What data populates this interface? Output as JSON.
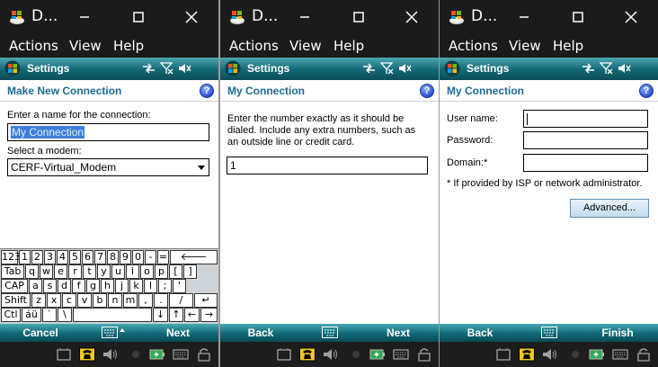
{
  "window": {
    "title": "D..."
  },
  "menu": {
    "actions": "Actions",
    "view": "View",
    "help": "Help"
  },
  "status": {
    "title": "Settings"
  },
  "panels": [
    {
      "heading": "Make New Connection",
      "name_label": "Enter a name for the connection:",
      "name_value": "My Connection",
      "modem_label": "Select a modem:",
      "modem_value": "CERF-Virtual_Modem",
      "left_soft": "Cancel",
      "right_soft": "Next"
    },
    {
      "heading": "My Connection",
      "instructions": "Enter the number exactly as it should be dialed.  Include any extra numbers, such as an outside line or credit card.",
      "number_value": "1",
      "left_soft": "Back",
      "right_soft": "Next"
    },
    {
      "heading": "My Connection",
      "username_label": "User name:",
      "username_value": "",
      "password_label": "Password:",
      "password_value": "",
      "domain_label": "Domain:*",
      "domain_value": "",
      "footnote": "* If provided by ISP or network administrator.",
      "advanced_button": "Advanced...",
      "left_soft": "Back",
      "right_soft": "Finish"
    }
  ],
  "keyboard": {
    "rows": [
      [
        "123",
        "1",
        "2",
        "3",
        "4",
        "5",
        "6",
        "7",
        "8",
        "9",
        "0",
        "-",
        "=",
        "🡐"
      ],
      [
        "Tab",
        "q",
        "w",
        "e",
        "r",
        "t",
        "y",
        "u",
        "i",
        "o",
        "p",
        "[",
        "]"
      ],
      [
        "CAP",
        "a",
        "s",
        "d",
        "f",
        "g",
        "h",
        "j",
        "k",
        "l",
        ";",
        "'"
      ],
      [
        "Shift",
        "z",
        "x",
        "c",
        "v",
        "b",
        "n",
        "m",
        ",",
        ".",
        "/",
        "↵"
      ],
      [
        "Ctl",
        "áü",
        "`",
        "\\",
        "",
        "↓",
        "↑",
        "←",
        "→"
      ]
    ]
  },
  "colors": {
    "titlebar": "#1b1b1b",
    "statusbar": "#136774",
    "heading_text": "#1b6b96",
    "selection": "#3d7fd8",
    "tray": "#1d1d1d"
  },
  "icons": {
    "app": "windows-flag-icon",
    "status": [
      "connectivity-icon",
      "signal-off-icon",
      "speaker-mute-icon"
    ],
    "tray": [
      "device-icon",
      "phone-icon",
      "volume-icon",
      "dot-icon",
      "battery-icon",
      "keyboard-icon",
      "lock-icon"
    ]
  }
}
